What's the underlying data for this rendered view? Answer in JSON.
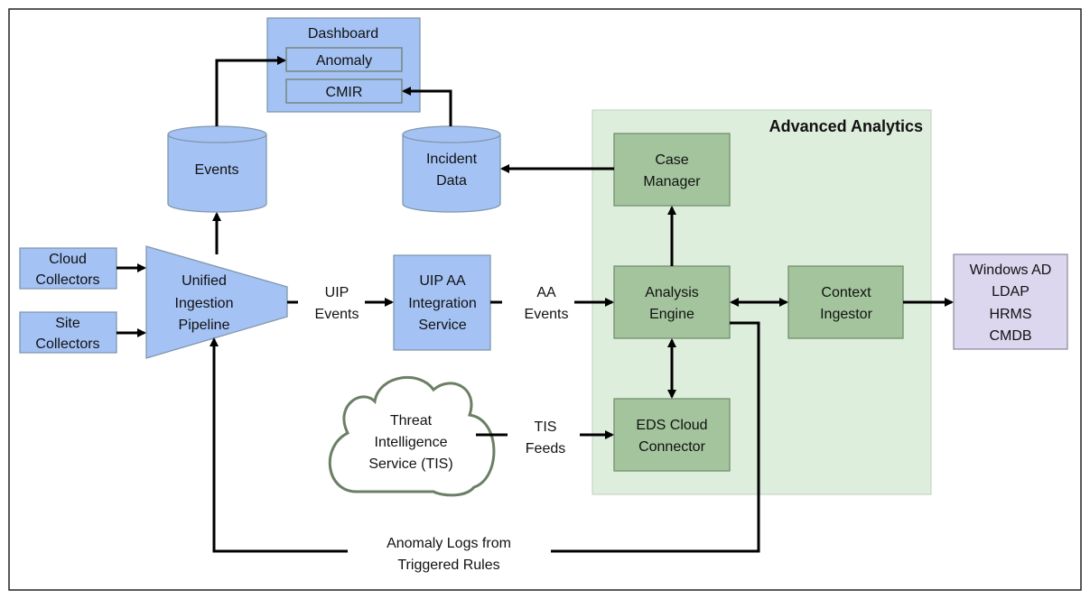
{
  "nodes": {
    "dashboard": {
      "label": "Dashboard",
      "anomaly": "Anomaly",
      "cmir": "CMIR"
    },
    "events_db": {
      "label": "Events"
    },
    "incident_db": {
      "line1": "Incident",
      "line2": "Data"
    },
    "cloud_collectors": {
      "line1": "Cloud",
      "line2": "Collectors"
    },
    "site_collectors": {
      "line1": "Site",
      "line2": "Collectors"
    },
    "pipeline": {
      "line1": "Unified",
      "line2": "Ingestion",
      "line3": "Pipeline"
    },
    "uip_aa": {
      "line1": "UIP AA",
      "line2": "Integration",
      "line3": "Service"
    },
    "group": {
      "title": "Advanced Analytics"
    },
    "case_manager": {
      "line1": "Case",
      "line2": "Manager"
    },
    "analysis_engine": {
      "line1": "Analysis",
      "line2": "Engine"
    },
    "context_ingestor": {
      "line1": "Context",
      "line2": "Ingestor"
    },
    "eds": {
      "line1": "EDS Cloud",
      "line2": "Connector"
    },
    "directory": {
      "line1": "Windows AD",
      "line2": "LDAP",
      "line3": "HRMS",
      "line4": "CMDB"
    },
    "tis": {
      "line1": "Threat",
      "line2": "Intelligence",
      "line3": "Service (TIS)"
    }
  },
  "edges": {
    "uip_events": {
      "line1": "UIP",
      "line2": "Events"
    },
    "aa_events": {
      "line1": "AA",
      "line2": "Events"
    },
    "tis_feeds": {
      "line1": "TIS",
      "line2": "Feeds"
    },
    "anomaly_logs": {
      "line1": "Anomaly Logs from",
      "line2": "Triggered Rules"
    }
  },
  "colors": {
    "data_store": "#a4c2f4",
    "analytics": "#a3c49d",
    "analytics_group": "#deeedd",
    "external": "#dcd6ee"
  }
}
